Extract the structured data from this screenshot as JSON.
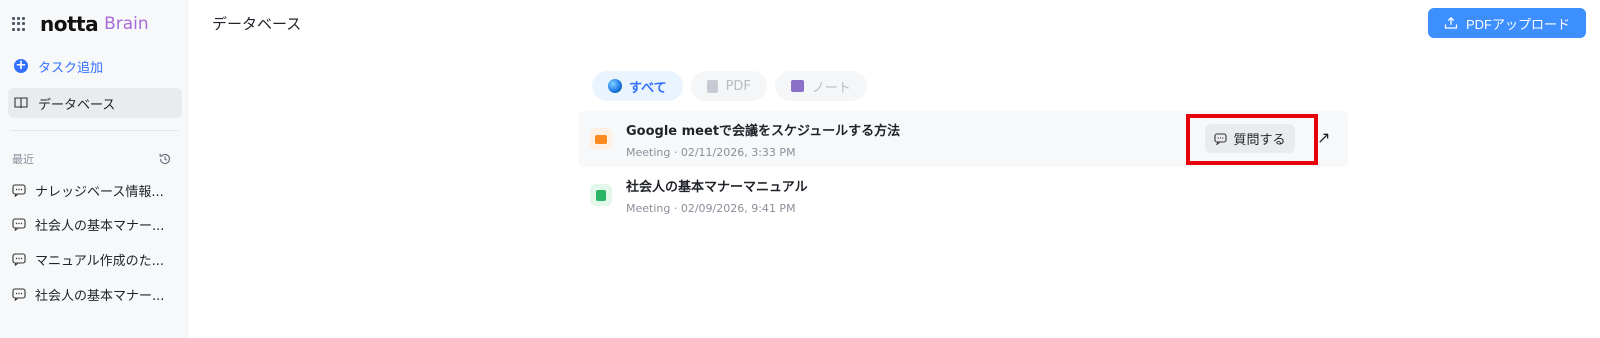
{
  "brand": {
    "logo": "notta",
    "sub": "Brain"
  },
  "sidebar": {
    "add_task": "タスク追加",
    "database": "データベース",
    "recent_label": "最近",
    "recent": [
      {
        "label": "ナレッジベース情報..."
      },
      {
        "label": "社会人の基本マナー..."
      },
      {
        "label": "マニュアル作成のた..."
      },
      {
        "label": "社会人の基本マナー..."
      }
    ]
  },
  "header": {
    "title": "データベース",
    "upload_label": "PDFアップロード"
  },
  "tabs": [
    {
      "label": "すべて",
      "active": true
    },
    {
      "label": "PDF",
      "active": false
    },
    {
      "label": "ノート",
      "active": false
    }
  ],
  "rows": [
    {
      "title": "Google meetで会議をスケジュールする方法",
      "meta": "Meeting · 02/11/2026, 3:33 PM",
      "type": "meeting"
    },
    {
      "title": "社会人の基本マナーマニュアル",
      "meta": "Meeting · 02/09/2026, 9:41 PM",
      "type": "note"
    }
  ],
  "row_actions": {
    "ask_label": "質問する",
    "open_icon": "↗"
  },
  "colors": {
    "accent": "#3370ff",
    "upload_button": "#3d8eff",
    "highlight": "#e8000b"
  },
  "icons": [
    "app-grid-icon",
    "plus-circle-icon",
    "book-icon",
    "history-icon",
    "chat-icon",
    "upload-icon",
    "globe-icon",
    "pdf-icon",
    "note-icon",
    "meet-icon",
    "ask-icon",
    "external-link-icon"
  ]
}
